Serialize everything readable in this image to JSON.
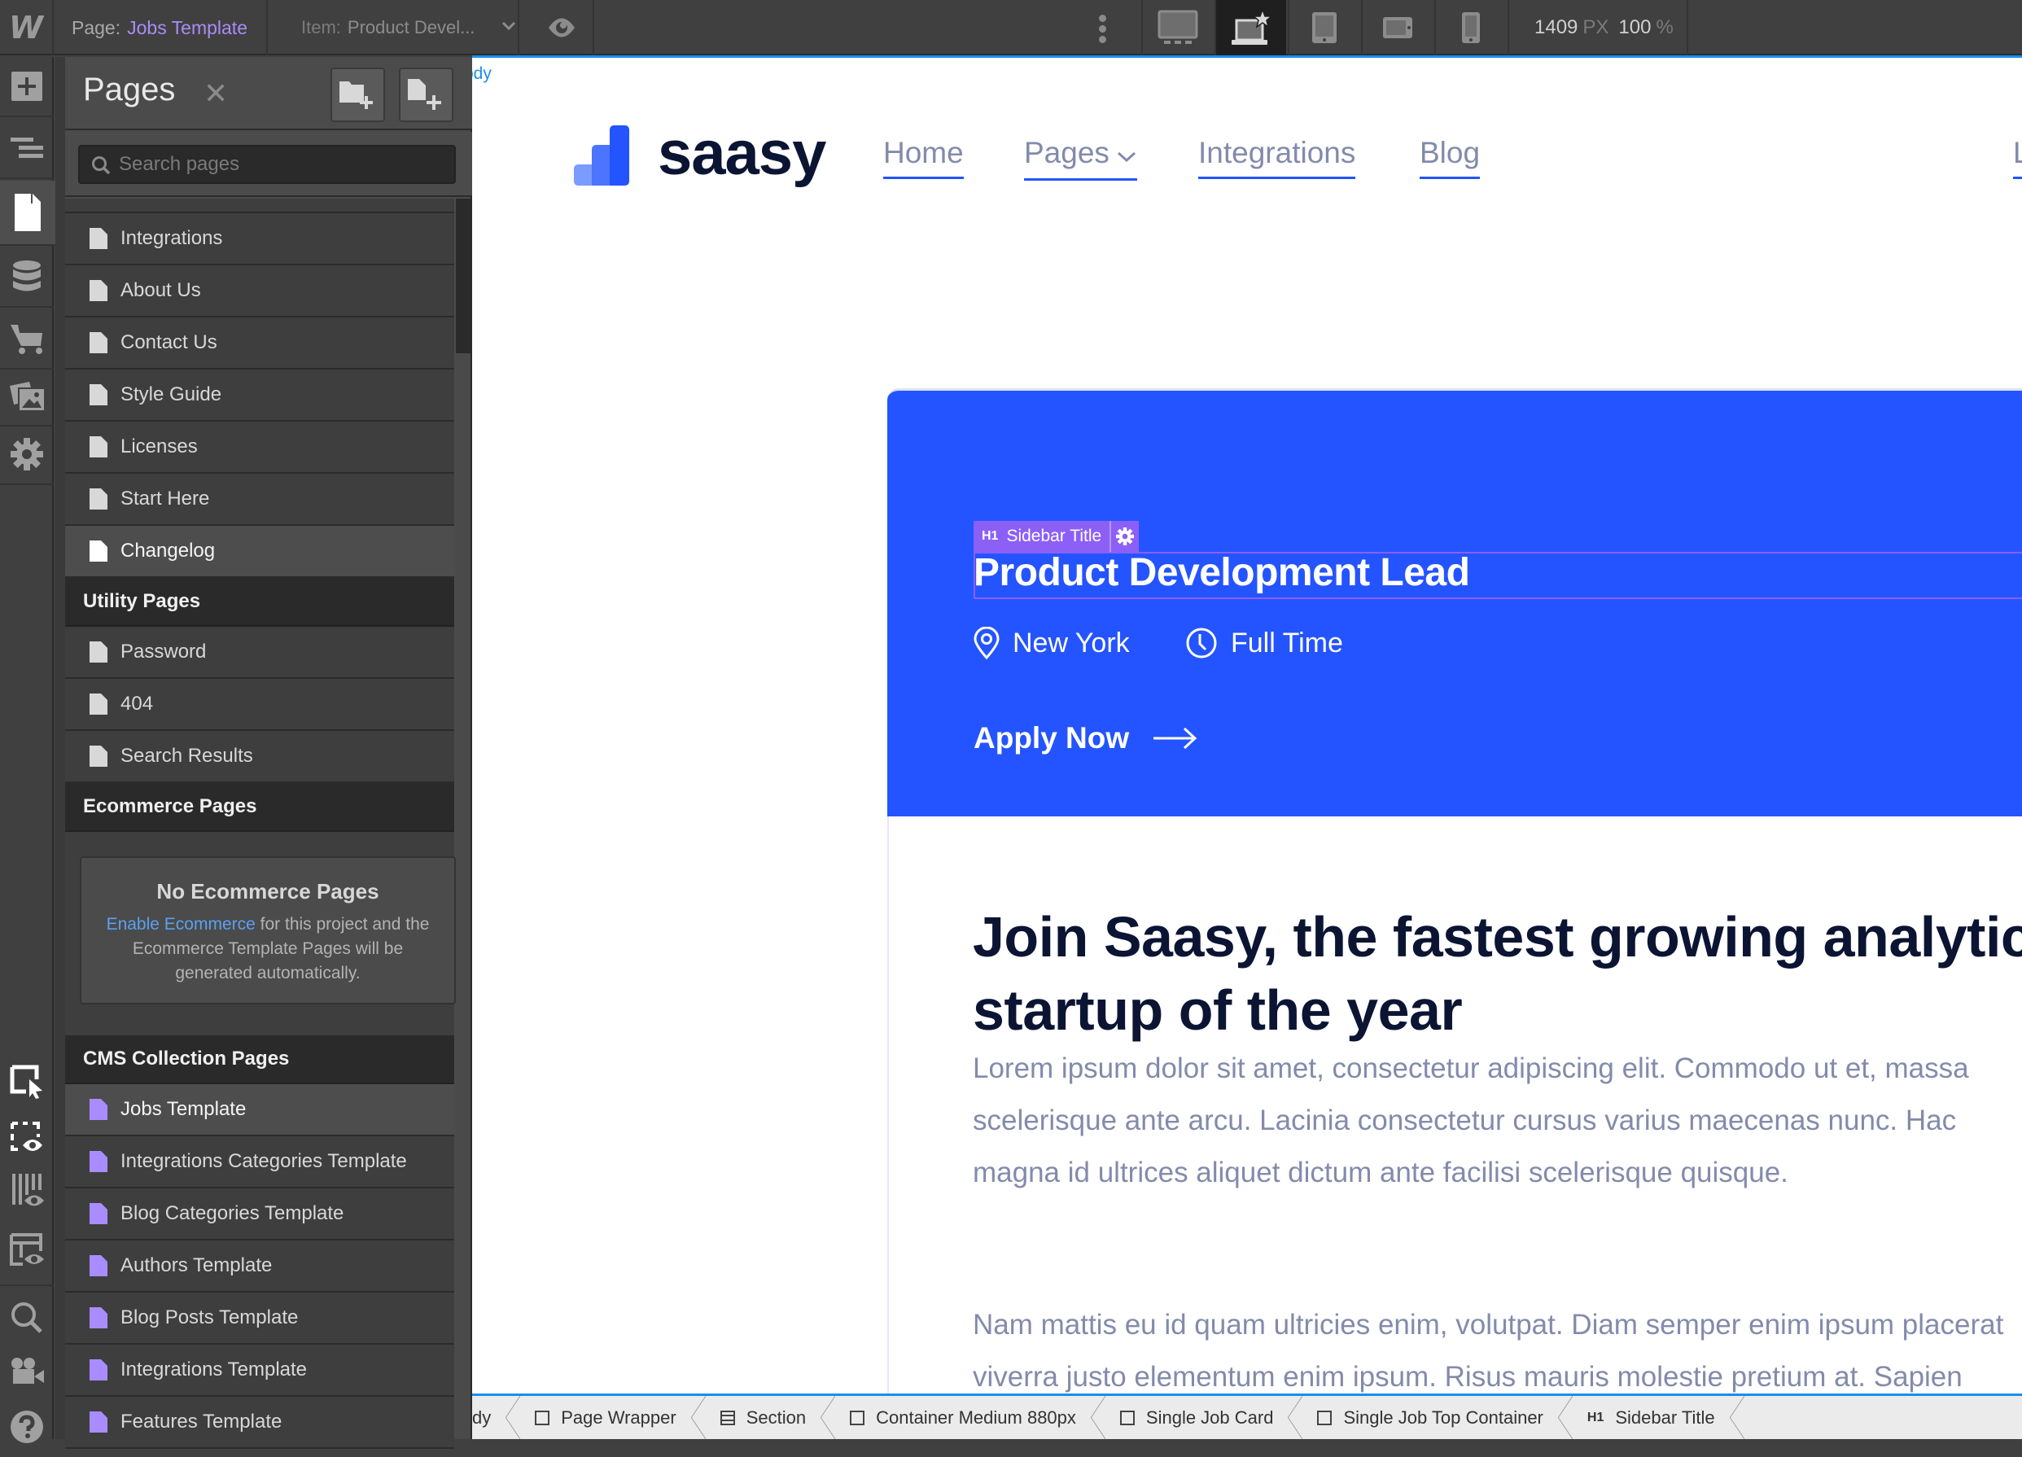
{
  "topbar": {
    "logo": "W",
    "page_label": "Page:",
    "page_value": "Jobs Template",
    "item_label": "Item:",
    "item_value": "Product Devel...",
    "breakpoints": [
      "desktop-large",
      "desktop-base",
      "tablet",
      "mobile-landscape",
      "mobile-portrait"
    ],
    "active_breakpoint": "desktop-base",
    "width_value": "1409",
    "width_unit": "PX",
    "zoom_value": "100",
    "zoom_unit": "%"
  },
  "rail": {
    "top": [
      "add-panel",
      "navigator",
      "pages",
      "cms",
      "ecommerce",
      "assets",
      "settings"
    ],
    "active": "pages",
    "bottom": [
      "select-mode",
      "show-element-edges",
      "x-ray",
      "preview-layout",
      "search",
      "video-tutorials",
      "help"
    ]
  },
  "panel": {
    "title": "Pages",
    "search_placeholder": "Search pages",
    "static_pages": [
      {
        "label": "Integrations"
      },
      {
        "label": "About Us"
      },
      {
        "label": "Contact Us"
      },
      {
        "label": "Style Guide"
      },
      {
        "label": "Licenses"
      },
      {
        "label": "Start Here"
      },
      {
        "label": "Changelog",
        "hover": true
      }
    ],
    "utility_header": "Utility Pages",
    "utility_pages": [
      {
        "label": "Password"
      },
      {
        "label": "404"
      },
      {
        "label": "Search Results"
      }
    ],
    "ecommerce_header": "Ecommerce Pages",
    "ecommerce_empty": {
      "title": "No Ecommerce Pages",
      "link": "Enable Ecommerce",
      "text": " for this project and the Ecommerce Template Pages will be generated automatically."
    },
    "cms_header": "CMS Collection Pages",
    "cms_pages": [
      {
        "label": "Jobs Template",
        "active": true
      },
      {
        "label": "Integrations Categories Template"
      },
      {
        "label": "Blog Categories Template"
      },
      {
        "label": "Authors Template"
      },
      {
        "label": "Blog Posts Template"
      },
      {
        "label": "Integrations Template"
      },
      {
        "label": "Features Template"
      }
    ]
  },
  "canvas": {
    "body_tag": "Body",
    "brand": "saasy",
    "nav": [
      {
        "label": "Home"
      },
      {
        "label": "Pages",
        "dropdown": true
      },
      {
        "label": "Integrations"
      },
      {
        "label": "Blog"
      },
      {
        "label": "L"
      }
    ],
    "selection": {
      "tag": "H1",
      "name": "Sidebar Title"
    },
    "job": {
      "title": "Product Development Lead",
      "location": "New York",
      "type": "Full Time",
      "apply": "Apply Now"
    },
    "intro_heading": "Join Saasy, the fastest growing analytics startup of the year",
    "paragraphs": [
      [
        "Lorem ipsum dolor sit amet, consectetur adipiscing elit. Commodo ut et, massa",
        "scelerisque ante arcu. Lacinia consectetur cursus varius maecenas nunc. Hac",
        "magna id ultrices aliquet dictum ante facilisi scelerisque quisque."
      ],
      [
        "Nam mattis eu id quam ultricies enim, volutpat. Diam semper enim ipsum placerat",
        "viverra justo elementum enim ipsum. Risus mauris molestie pretium at. Sapien"
      ]
    ],
    "colors": {
      "brand_blue": "#2454ff",
      "heading": "#0b1533",
      "body_text": "#838bab",
      "selection": "#8c5ff7"
    }
  },
  "breadcrumbs": [
    {
      "label": "Body",
      "shown": "dy",
      "icon": "none"
    },
    {
      "label": "Page Wrapper",
      "icon": "box"
    },
    {
      "label": "Section",
      "icon": "section"
    },
    {
      "label": "Container Medium 880px",
      "icon": "box"
    },
    {
      "label": "Single Job Card",
      "icon": "box"
    },
    {
      "label": "Single Job Top Container",
      "icon": "box"
    },
    {
      "label": "Sidebar Title",
      "icon": "h1"
    }
  ]
}
